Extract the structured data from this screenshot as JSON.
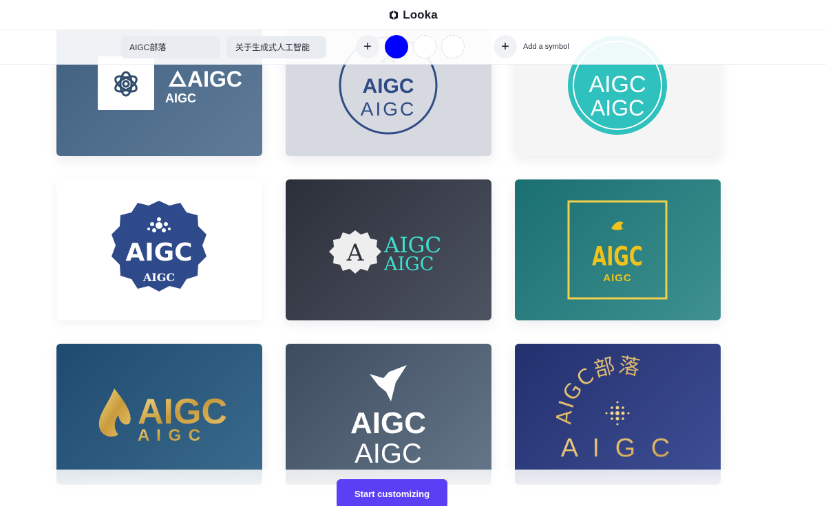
{
  "brand": {
    "name": "Looka"
  },
  "toolbar": {
    "company_name_value": "AIGC部落",
    "slogan_value": "关于生成式人工智能",
    "add_symbol_label": "Add a symbol",
    "colors": [
      "#0000ff"
    ]
  },
  "logos": [
    {
      "primary": "AIGC",
      "secondary": "AIGC",
      "background": "#4a6a8a"
    },
    {
      "primary": "AIGC",
      "secondary": "AIGC",
      "background": "#d6d9e0"
    },
    {
      "primary": "AIGC",
      "secondary": "AIGC",
      "background": "#f5f5f6"
    },
    {
      "primary": "AIGC",
      "secondary": "AIGC",
      "background": "#ffffff"
    },
    {
      "primary": "AIGC",
      "secondary": "AIGC",
      "emblem_letter": "A",
      "background": "#363b47"
    },
    {
      "primary": "AIGC",
      "secondary": "AIGC",
      "background": "#2a807f"
    },
    {
      "primary": "AIGC",
      "secondary": "A I G C",
      "background": "#2b5a7d"
    },
    {
      "primary": "AIGC",
      "secondary": "AIGC",
      "background": "#4f5f73"
    },
    {
      "arc_text": "AIGC部落",
      "secondary": "A I G C",
      "background": "#303f82"
    }
  ],
  "cta": {
    "label": "Start customizing"
  }
}
